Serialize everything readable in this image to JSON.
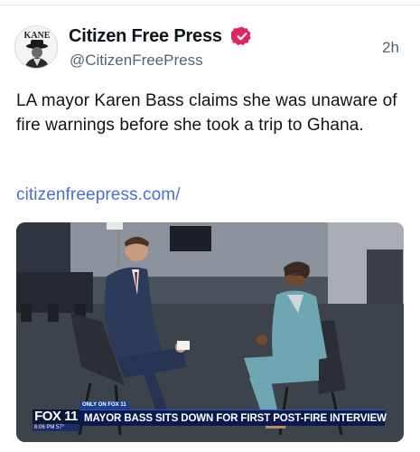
{
  "post": {
    "author_name": "Citizen Free Press",
    "author_handle": "@CitizenFreePress",
    "avatar_text": "KANE",
    "timestamp": "2h",
    "text": "LA mayor Karen Bass claims she was unaware of fire warnings before she took a trip to Ghana.",
    "link": "citizenfreepress.com/",
    "verified_color": "#e0245e",
    "link_color": "#4a6fd1"
  },
  "media": {
    "chyron": {
      "tag": "ONLY ON FOX 11",
      "logo": "FOX 11",
      "headline": "MAYOR BASS SITS DOWN FOR FIRST POST-FIRE INTERVIEW",
      "time": "6:06 PM",
      "temperature": "57°"
    }
  },
  "icons": {
    "verified": "verified-badge-icon"
  }
}
